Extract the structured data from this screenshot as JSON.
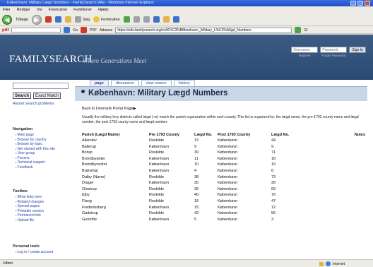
{
  "window": {
    "title": "København: Military Lægd Numbers - FamilySearch Wiki - Windows Internet Explorer"
  },
  "menu": [
    "Filer",
    "Rediger",
    "Vis",
    "Foretrukne",
    "Funktioner",
    "Hjælp"
  ],
  "toolbar": {
    "back_label": "Tilbage",
    "search_label": "Søg",
    "favorites_label": "Foretrukne"
  },
  "address_bar": {
    "pdf_label": "pdf",
    "go_label": "Go",
    "pdf_button": "PDF",
    "address_label": "Adresse",
    "url": "https://wiki.familysearch.org/en/K%C3%B8benhavn:_Military_L%C3%A6gd_Numbers",
    "links_label": "Gl"
  },
  "site": {
    "logo": "FAMILYSEARCH",
    "tagline": "Where Generations Meet",
    "username_placeholder": "Username",
    "password_placeholder": "Password",
    "register_label": "Register",
    "forgot_label": "Forgot Password",
    "signin_label": "Sign In"
  },
  "sidebar": {
    "search_button": "Search",
    "exact_button": "Exact Match",
    "report_link": "Report search problems",
    "navigation_title": "Navigation",
    "navigation_items": [
      "Main page",
      "Browse by country",
      "Browse by topic",
      "Get started with this site",
      "User group",
      "Forums",
      "Technical support",
      "Feedback"
    ],
    "toolbox_title": "Toolbox",
    "toolbox_items": [
      "What links here",
      "Related changes",
      "Special pages",
      "Printable version",
      "Permanent link",
      "Upload file"
    ],
    "personal_title": "Personal tools",
    "personal_items": [
      "Log in / create account"
    ]
  },
  "tabs": [
    "page",
    "discussion",
    "view source",
    "history"
  ],
  "article": {
    "title": "København: Military Lægd Numbers",
    "back_link": "Back to Denmark Portal Page▶",
    "intro": "Usually the military levy districts called lægd (-er) match the parish organization within each county. This list is organized by: the lægd name, the pre-1793 county name and lægd number, the post 1793 county name and lægd number."
  },
  "table": {
    "headers": [
      "Parish (Lægd Name)",
      "Pre 1793 County",
      "Lægd No.",
      "Post 1793 County",
      "Lægd No.",
      "Notes"
    ],
    "rows": [
      [
        "Allerslev",
        "Roskilde",
        "13",
        "København",
        "44",
        ""
      ],
      [
        "Ballerup",
        "København",
        "9",
        "København",
        "9",
        ""
      ],
      [
        "Borup",
        "Roskilde",
        "39",
        "København",
        "71",
        ""
      ],
      [
        "Brondbyøster",
        "København",
        "11",
        "København",
        "18",
        ""
      ],
      [
        "Brondbyvester",
        "København",
        "10",
        "København",
        "19",
        ""
      ],
      [
        "Brønshøj",
        "København",
        "4",
        "København",
        "6",
        ""
      ],
      [
        "Dalby (Nørre)",
        "Roskilde",
        "38",
        "København",
        "73",
        ""
      ],
      [
        "Drager",
        "København",
        "30",
        "København",
        "28",
        ""
      ],
      [
        "Glostrup",
        "Roskilde",
        "36",
        "København",
        "69",
        ""
      ],
      [
        "Ejby",
        "Roskilde",
        "40",
        "København",
        "76",
        ""
      ],
      [
        "Flang",
        "Roskilde",
        "18",
        "København",
        "47",
        ""
      ],
      [
        "Frederiksberg",
        "København",
        "15",
        "København",
        "12",
        ""
      ],
      [
        "Gadstrup",
        "Roskilde",
        "42",
        "København",
        "56",
        ""
      ],
      [
        "Gentofte",
        "København",
        "5",
        "København",
        "3",
        ""
      ]
    ]
  },
  "status": {
    "left": "Udført",
    "zone": "Internet"
  }
}
